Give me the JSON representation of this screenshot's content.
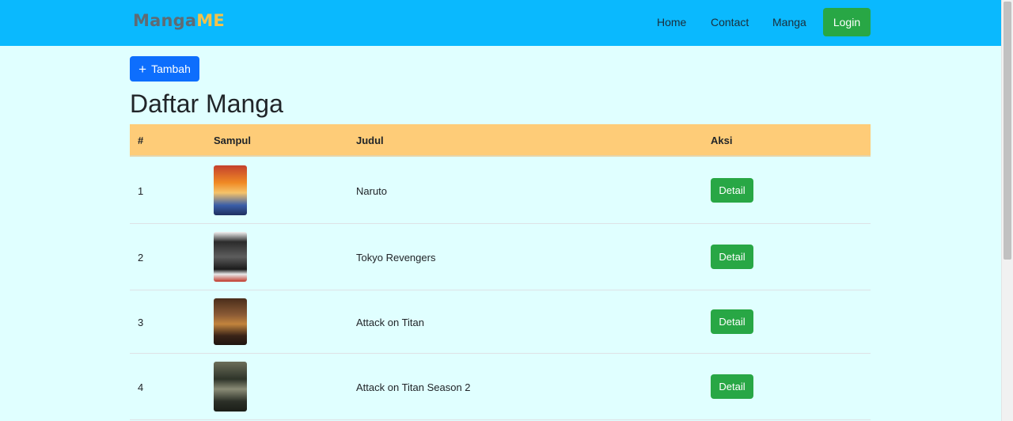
{
  "navbar": {
    "brand_part1": "Manga",
    "brand_part2": "ME",
    "links": [
      "Home",
      "Contact",
      "Manga"
    ],
    "login_label": "Login",
    "background": "#0ab9fe"
  },
  "toolbar": {
    "add_icon": "plus-icon",
    "add_label": "Tambah"
  },
  "page": {
    "title": "Daftar Manga"
  },
  "table": {
    "headers": [
      "#",
      "Sampul",
      "Judul",
      "Aksi"
    ],
    "rows": [
      {
        "num": "1",
        "title": "Naruto",
        "action": "Detail"
      },
      {
        "num": "2",
        "title": "Tokyo Revengers",
        "action": "Detail"
      },
      {
        "num": "3",
        "title": "Attack on Titan",
        "action": "Detail"
      },
      {
        "num": "4",
        "title": "Attack on Titan Season 2",
        "action": "Detail"
      }
    ],
    "header_color": "#fecc78"
  },
  "colors": {
    "page_background": "#e0ffff",
    "primary": "#0d6efd",
    "success": "#28a745"
  }
}
